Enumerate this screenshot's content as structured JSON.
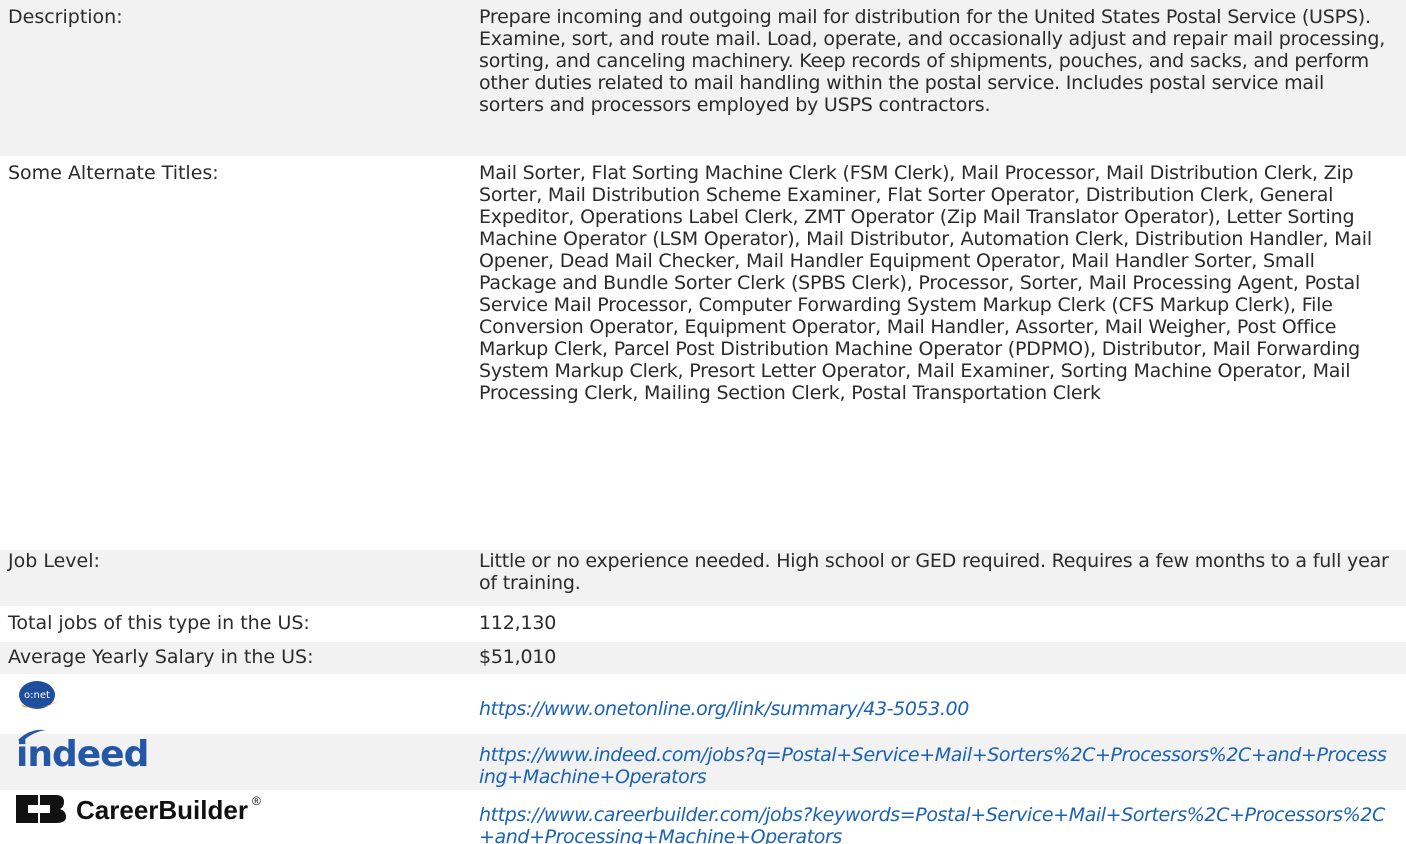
{
  "rows": {
    "description": {
      "label": "Description:",
      "value": "Prepare incoming and outgoing mail for distribution for the United States Postal Service (USPS). Examine, sort, and route mail. Load, operate, and occasionally adjust and repair mail processing, sorting, and canceling machinery. Keep records of shipments, pouches, and sacks, and perform other duties related to mail handling within the postal service. Includes postal service mail sorters and processors employed by USPS contractors."
    },
    "alternate_titles": {
      "label": "Some Alternate Titles:",
      "value": "Mail Sorter, Flat Sorting Machine Clerk (FSM Clerk), Mail Processor, Mail Distribution Clerk, Zip Sorter, Mail Distribution Scheme Examiner, Flat Sorter Operator, Distribution Clerk, General Expeditor, Operations Label Clerk, ZMT Operator (Zip Mail Translator Operator), Letter Sorting Machine Operator (LSM Operator), Mail Distributor, Automation Clerk, Distribution Handler, Mail Opener, Dead Mail Checker, Mail Handler Equipment Operator, Mail Handler Sorter, Small Package and Bundle Sorter Clerk (SPBS Clerk), Processor, Sorter, Mail Processing Agent, Postal Service Mail Processor, Computer Forwarding System Markup Clerk (CFS Markup Clerk), File Conversion Operator, Equipment Operator, Mail Handler, Assorter, Mail Weigher, Post Office Markup Clerk, Parcel Post Distribution Machine Operator (PDPMO), Distributor, Mail Forwarding System Markup Clerk, Presort Letter Operator, Mail Examiner, Sorting Machine Operator, Mail Processing Clerk, Mailing Section Clerk, Postal Transportation Clerk"
    },
    "job_level": {
      "label": "Job Level:",
      "value": "Little or no experience needed. High school or GED required. Requires a few months to a full year of training."
    },
    "total_jobs": {
      "label": "Total jobs of this type in the US:",
      "value": "112,130"
    },
    "salary": {
      "label": "Average Yearly Salary in the US:",
      "value": "$51,010"
    }
  },
  "links": {
    "onet": {
      "logo_text": "o:net",
      "url": "https://www.onetonline.org/link/summary/43-5053.00"
    },
    "indeed": {
      "logo_text": "indeed",
      "url": "https://www.indeed.com/jobs?q=Postal+Service+Mail+Sorters%2C+Processors%2C+and+Processing+Machine+Operators"
    },
    "careerbuilder": {
      "logo_text": "CareerBuilder",
      "registered_mark": "®",
      "url": "https://www.careerbuilder.com/jobs?keywords=Postal+Service+Mail+Sorters%2C+Processors%2C+and+Processing+Machine+Operators"
    }
  },
  "colors": {
    "text": "#2b2b2b",
    "link": "#1a62b5",
    "band": "#f2f2f2",
    "indeed_blue": "#2557a7",
    "onet_blue": "#1f4e9c",
    "onet_gold": "#f2b233",
    "careerbuilder_black": "#111111"
  }
}
